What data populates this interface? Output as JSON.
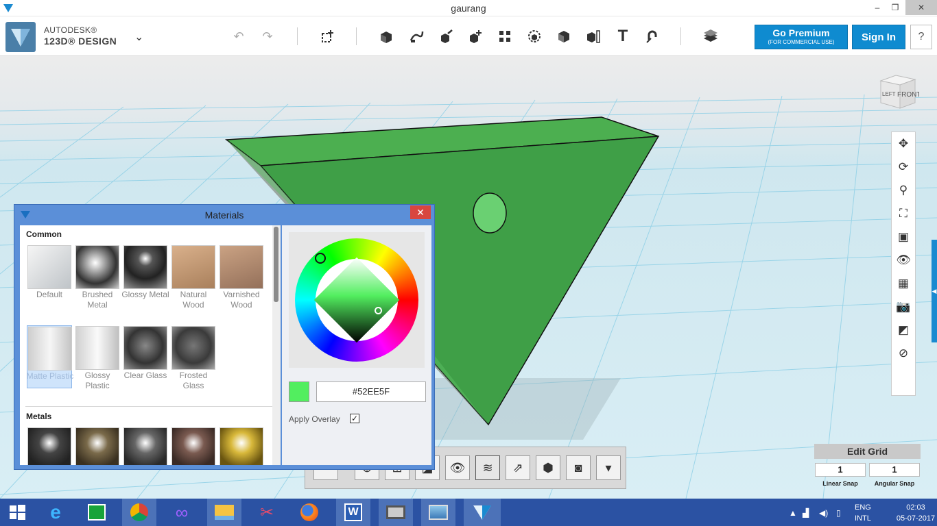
{
  "window": {
    "title": "gaurang",
    "minimize": "‒",
    "restore": "❐",
    "close": "✕"
  },
  "app": {
    "brand_line1": "AUTODESK®",
    "brand_line2": "123D® DESIGN",
    "menu_glyph": "⌄"
  },
  "toolbar": {
    "items": [
      "undo-icon",
      "redo-icon",
      "primitives-icon",
      "sketch-icon",
      "construct-icon",
      "modify-icon",
      "pattern-icon",
      "grouping-icon",
      "combine-icon",
      "measure-icon",
      "text-icon",
      "snap-icon",
      "material-icon"
    ],
    "text_tool_label": "T",
    "premium_title": "Go Premium",
    "premium_sub": "(FOR COMMERCIAL USE)",
    "signin": "Sign In",
    "help": "?"
  },
  "viewcube": {
    "left": "LEFT",
    "front": "FRONT"
  },
  "edit_grid": {
    "title": "Edit Grid",
    "linear_snap_value": "1",
    "linear_snap_label": "Linear Snap",
    "angular_snap_value": "1",
    "angular_snap_label": "Angular Snap"
  },
  "materials": {
    "title": "Materials",
    "close": "✕",
    "sections": {
      "common": "Common",
      "metals": "Metals"
    },
    "common_row1": [
      "Default",
      "Brushed Metal",
      "Glossy Metal",
      "Natural Wood",
      "Varnished Wood"
    ],
    "common_row2": [
      "Matte Plastic",
      "Glossy Plastic",
      "Clear Glass",
      "Frosted Glass"
    ],
    "selected": "Matte Plastic",
    "hex_value": "#52EE5F",
    "apply_overlay": "Apply Overlay",
    "apply_overlay_checked": "✓"
  },
  "colors": {
    "accent": "#0f8bd0",
    "object_green": "#52EE5F",
    "taskbar": "#2b52a3"
  },
  "taskbar": {
    "apps": [
      "start-icon",
      "internet-explorer-icon",
      "store-icon",
      "chrome-icon",
      "infinity-app-icon",
      "file-explorer-icon",
      "paint-icon",
      "firefox-icon",
      "word-icon",
      "remote-desktop-icon",
      "photos-icon",
      "123d-design-icon"
    ],
    "lang_line1": "ENG",
    "lang_line2": "INTL",
    "time": "02:03",
    "date": "05-07-2017"
  }
}
